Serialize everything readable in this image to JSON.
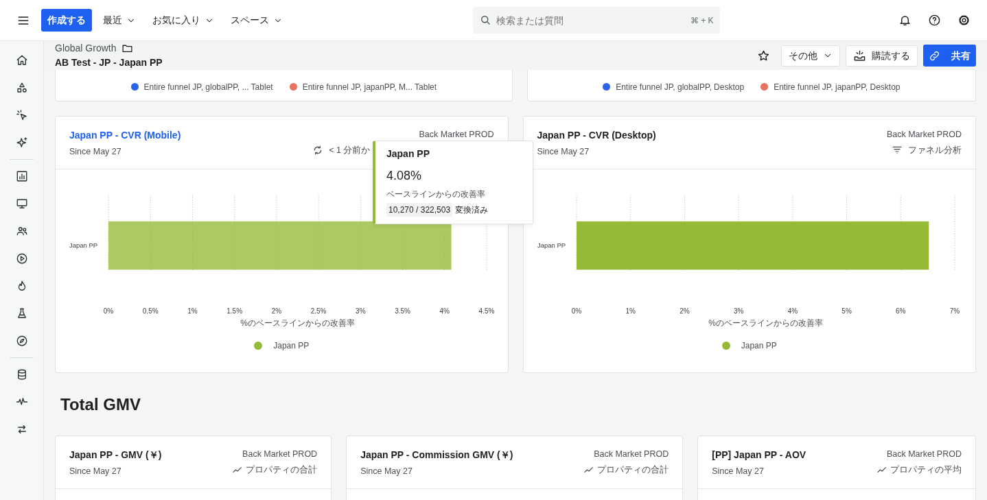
{
  "topbar": {
    "create_button": "作成する",
    "menus": [
      {
        "label": "最近"
      },
      {
        "label": "お気に入り"
      },
      {
        "label": "スペース"
      }
    ],
    "search": {
      "placeholder": "検索または質問",
      "shortcut": "⌘ + K"
    }
  },
  "header": {
    "breadcrumb": "Global Growth",
    "title": "AB Test - JP - Japan PP",
    "more_button": "その他",
    "subscribe_button": "購読する",
    "share_button": "共有"
  },
  "partial_cards": [
    {
      "legend": [
        {
          "label": "Entire funnel JP, globalPP, ...  Tablet",
          "color": "#2b63e6"
        },
        {
          "label": "Entire funnel JP, japanPP, M...  Tablet",
          "color": "#e8725e"
        }
      ]
    },
    {
      "legend": [
        {
          "label": "Entire funnel JP, globalPP, Desktop",
          "color": "#2b63e6"
        },
        {
          "label": "Entire funnel JP, japanPP, Desktop",
          "color": "#e8725e"
        }
      ]
    }
  ],
  "chart_cards": [
    {
      "title": "Japan PP - CVR (Mobile)",
      "hovered": true,
      "source": "Back Market PROD",
      "since": "Since May 27",
      "status": {
        "kind": "refresh",
        "text": "< 1 分前か"
      },
      "chart_data": {
        "type": "bar",
        "orientation": "horizontal",
        "grid": true,
        "categories": [
          "Japan PP"
        ],
        "series": [
          {
            "name": "Japan PP",
            "color": "#95bb36",
            "values": [
              4.08
            ]
          }
        ],
        "xlabel": "%のベースラインからの改善率",
        "xlim": [
          0,
          4.5
        ],
        "xticks": [
          {
            "value": 0,
            "label": "0%"
          },
          {
            "value": 0.5,
            "label": "0.5%"
          },
          {
            "value": 1,
            "label": "1%"
          },
          {
            "value": 1.5,
            "label": "1.5%"
          },
          {
            "value": 2,
            "label": "2%"
          },
          {
            "value": 2.5,
            "label": "2.5%"
          },
          {
            "value": 3,
            "label": "3%"
          },
          {
            "value": 3.5,
            "label": "3.5%"
          },
          {
            "value": 4,
            "label": "4%"
          },
          {
            "value": 4.5,
            "label": "4.5%"
          }
        ]
      }
    },
    {
      "title": "Japan PP - CVR (Desktop)",
      "hovered": false,
      "source": "Back Market PROD",
      "since": "Since May 27",
      "status": {
        "kind": "funnel",
        "text": "ファネル分析"
      },
      "chart_data": {
        "type": "bar",
        "orientation": "horizontal",
        "grid": true,
        "categories": [
          "Japan PP"
        ],
        "series": [
          {
            "name": "Japan PP",
            "color": "#95bb36",
            "values": [
              6.52
            ]
          }
        ],
        "xlabel": "%のベースラインからの改善率",
        "xlim": [
          0,
          7
        ],
        "xticks": [
          {
            "value": 0,
            "label": "0%"
          },
          {
            "value": 1,
            "label": "1%"
          },
          {
            "value": 2,
            "label": "2%"
          },
          {
            "value": 3,
            "label": "3%"
          },
          {
            "value": 4,
            "label": "4%"
          },
          {
            "value": 5,
            "label": "5%"
          },
          {
            "value": 6,
            "label": "6%"
          },
          {
            "value": 7,
            "label": "7%"
          }
        ]
      }
    }
  ],
  "tooltip": {
    "title": "Japan PP",
    "value": "4.08%",
    "caption": "ベースラインからの改善率",
    "count": "10,270 / 322,503",
    "count_suffix": "変換済み"
  },
  "section_title": "Total GMV",
  "metric_cards": [
    {
      "title": "Japan PP - GMV (￥)",
      "source": "Back Market PROD",
      "since": "Since May 27",
      "measure": "プロパティの合計"
    },
    {
      "title": "Japan PP - Commission GMV (￥)",
      "source": "Back Market PROD",
      "since": "Since May 27",
      "measure": "プロパティの合計"
    },
    {
      "title": "[PP] Japan PP - AOV",
      "source": "Back Market PROD",
      "since": "Since May 27",
      "measure": "プロパティの平均"
    }
  ]
}
